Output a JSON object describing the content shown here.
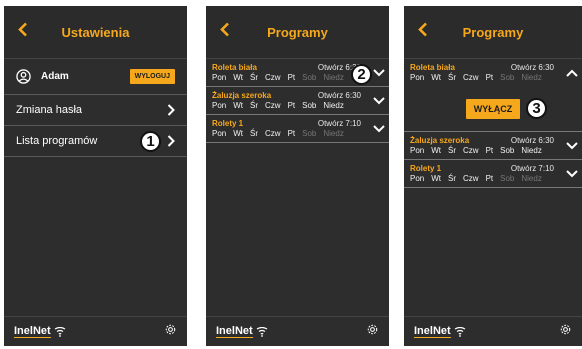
{
  "colors": {
    "accent": "#f6a81c",
    "background": "#2d2d2d",
    "text": "#ffffff",
    "inactive_day": "#767676"
  },
  "settings_screen": {
    "title": "Ustawienia",
    "user_name": "Adam",
    "logout_label": "WYLOGUJ",
    "change_password_label": "Zmiana hasła",
    "programs_list_label": "Lista programów",
    "step_badge": "1"
  },
  "programs_screen": {
    "title": "Programy",
    "step_badge": "2",
    "programs": [
      {
        "name": "Roleta biała",
        "time": "Otwórz 6:30",
        "days": [
          {
            "label": "Pon",
            "active": true
          },
          {
            "label": "Wt",
            "active": true
          },
          {
            "label": "Śr",
            "active": true
          },
          {
            "label": "Czw",
            "active": true
          },
          {
            "label": "Pt",
            "active": true
          },
          {
            "label": "Sob",
            "active": false
          },
          {
            "label": "Niedz",
            "active": false
          }
        ]
      },
      {
        "name": "Żaluzja szeroka",
        "time": "Otwórz 6:30",
        "days": [
          {
            "label": "Pon",
            "active": true
          },
          {
            "label": "Wt",
            "active": true
          },
          {
            "label": "Śr",
            "active": true
          },
          {
            "label": "Czw",
            "active": true
          },
          {
            "label": "Pt",
            "active": true
          },
          {
            "label": "Sob",
            "active": true
          },
          {
            "label": "Niedz",
            "active": true
          }
        ]
      },
      {
        "name": "Rolety 1",
        "time": "Otwórz 7:10",
        "days": [
          {
            "label": "Pon",
            "active": true
          },
          {
            "label": "Wt",
            "active": true
          },
          {
            "label": "Śr",
            "active": true
          },
          {
            "label": "Czw",
            "active": true
          },
          {
            "label": "Pt",
            "active": true
          },
          {
            "label": "Sob",
            "active": false
          },
          {
            "label": "Niedz",
            "active": false
          }
        ]
      }
    ]
  },
  "expanded_screen": {
    "title": "Programy",
    "off_button_label": "WYŁĄCZ",
    "step_badge": "3"
  },
  "footer": {
    "logo_text": "InelNet"
  },
  "icons": {
    "back": "chevron-left-icon",
    "forward": "chevron-right-icon",
    "expand": "chevron-down-icon",
    "collapse": "chevron-up-icon",
    "user": "user-icon",
    "settings": "gear-icon",
    "wifi": "wifi-icon"
  }
}
